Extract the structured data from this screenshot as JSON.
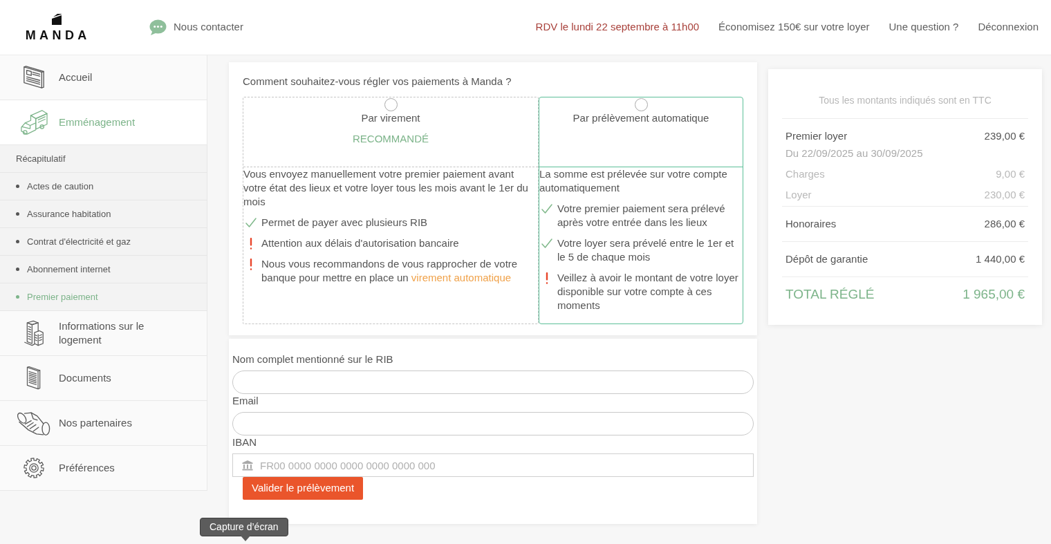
{
  "header": {
    "logo": "MANDA",
    "contact": "Nous contacter",
    "nav": [
      {
        "text": "RDV le lundi 22 septembre à 11h00",
        "kind": "appointment"
      },
      {
        "text": "Économisez 150€ sur votre loyer",
        "kind": "link"
      },
      {
        "text": "Une question ?",
        "kind": "link"
      },
      {
        "text": "Déconnexion",
        "kind": "link"
      }
    ]
  },
  "sidebar": {
    "items": [
      {
        "label": "Accueil",
        "selected": false
      },
      {
        "label": "Emménagement",
        "selected": true,
        "children": [
          {
            "label": "Récapitulatif",
            "kind": "heading",
            "selected": false
          },
          {
            "label": "Actes de caution",
            "kind": "step",
            "selected": false
          },
          {
            "label": "Assurance habitation",
            "kind": "step",
            "selected": false
          },
          {
            "label": "Contrat d'électricité et gaz",
            "kind": "step",
            "selected": false
          },
          {
            "label": "Abonnement internet",
            "kind": "step",
            "selected": false
          },
          {
            "label": "Premier paiement",
            "kind": "step",
            "selected": true
          }
        ]
      },
      {
        "label": "Informations sur le logement",
        "selected": false
      },
      {
        "label": "Documents",
        "selected": false
      },
      {
        "label": "Nos partenaires",
        "selected": false
      },
      {
        "label": "Préférences",
        "selected": false
      }
    ]
  },
  "payment": {
    "question": "Comment souhaitez-vous régler vos paiements à Manda ?",
    "options": [
      {
        "title": "Par virement",
        "badge": "RECOMMANDÉ",
        "selected": false,
        "description": "Vous envoyez manuellement votre premier paiement avant votre état des lieux et votre loyer tous les mois avant le 1er du mois",
        "points": [
          {
            "kind": "ok",
            "text": "Permet de payer avec plusieurs RIB"
          },
          {
            "kind": "warn",
            "text": "Attention aux délais d'autorisation bancaire"
          },
          {
            "kind": "warn",
            "text": "Nous vous recommandons de vous rapprocher de votre banque pour mettre en place un",
            "link": "virement automatique"
          }
        ]
      },
      {
        "title": "Par prélèvement automatique",
        "selected": true,
        "description": "La somme est prélevée sur votre compte automatiquement",
        "points": [
          {
            "kind": "ok",
            "text": "Votre premier paiement sera prélevé après votre entrée dans les lieux"
          },
          {
            "kind": "ok",
            "text": "Votre loyer sera prévelé entre le 1er et le 5 de chaque mois"
          },
          {
            "kind": "warn",
            "text": "Veillez à avoir le montant de votre loyer disponible sur votre compte à ces moments"
          }
        ]
      }
    ]
  },
  "form": {
    "fields": [
      {
        "label": "Nom complet mentionné sur le RIB",
        "kind": "text"
      },
      {
        "label": "Email",
        "kind": "text"
      },
      {
        "label": "IBAN",
        "kind": "iban",
        "placeholder": "FR00 0000 0000 0000 0000 0000 000"
      }
    ],
    "submit": "Valider le prélèvement"
  },
  "summary": {
    "note": "Tous les montants indiqués sont en TTC",
    "groups": [
      {
        "rows": [
          {
            "label": "Premier loyer",
            "amount": "239,00 €",
            "kind": "main",
            "detail": "Du 22/09/2025 au 30/09/2025"
          },
          {
            "label": "Charges",
            "amount": "9,00 €",
            "kind": "sub"
          },
          {
            "label": "Loyer",
            "amount": "230,00 €",
            "kind": "sub"
          }
        ]
      },
      {
        "rows": [
          {
            "label": "Honoraires",
            "amount": "286,00 €",
            "kind": "main"
          }
        ]
      },
      {
        "rows": [
          {
            "label": "Dépôt de garantie",
            "amount": "1 440,00 €",
            "kind": "main"
          }
        ]
      }
    ],
    "total": {
      "label": "TOTAL RÉGLÉ",
      "amount": "1 965,00 €"
    }
  },
  "tooltip": {
    "text": "Capture d’écran"
  }
}
